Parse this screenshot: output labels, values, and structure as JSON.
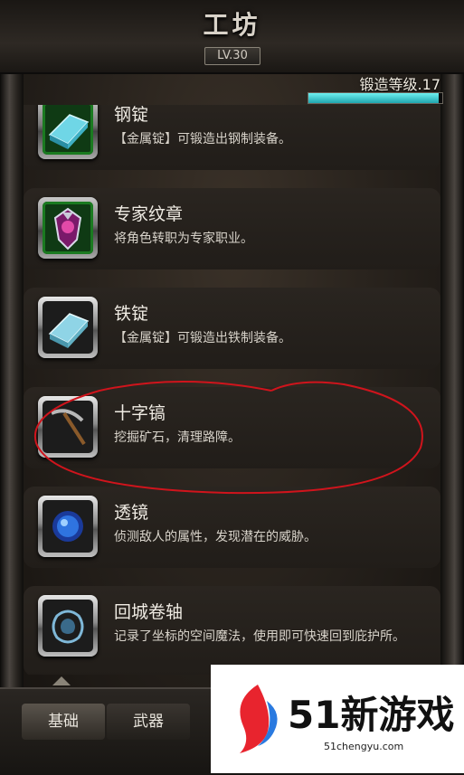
{
  "header": {
    "title": "工坊",
    "level_badge": "LV.30",
    "forge_level_label": "锻造等级.17",
    "forge_progress": 0.97
  },
  "items": [
    {
      "name": "钢锭",
      "desc": "【金属锭】可锻造出钢制装备。",
      "icon": "steel-ingot-icon"
    },
    {
      "name": "专家纹章",
      "desc": "将角色转职为专家职业。",
      "icon": "expert-emblem-icon"
    },
    {
      "name": "铁锭",
      "desc": "【金属锭】可锻造出铁制装备。",
      "icon": "iron-ingot-icon"
    },
    {
      "name": "十字镐",
      "desc": "挖掘矿石，清理路障。",
      "icon": "pickaxe-icon"
    },
    {
      "name": "透镜",
      "desc": "侦测敌人的属性，发现潜在的威胁。",
      "icon": "lens-icon"
    },
    {
      "name": "回城卷轴",
      "desc": "记录了坐标的空间魔法，使用即可快速回到庇护所。",
      "icon": "return-scroll-icon"
    }
  ],
  "tabs": [
    {
      "label": "基础",
      "active": true
    },
    {
      "label": "武器",
      "active": false
    }
  ],
  "watermark": {
    "brand": "51新游戏",
    "domain": "51chengyu.com"
  },
  "colors": {
    "progress_fill": "#1fa5ae",
    "annotation_circle": "#d0141c"
  }
}
